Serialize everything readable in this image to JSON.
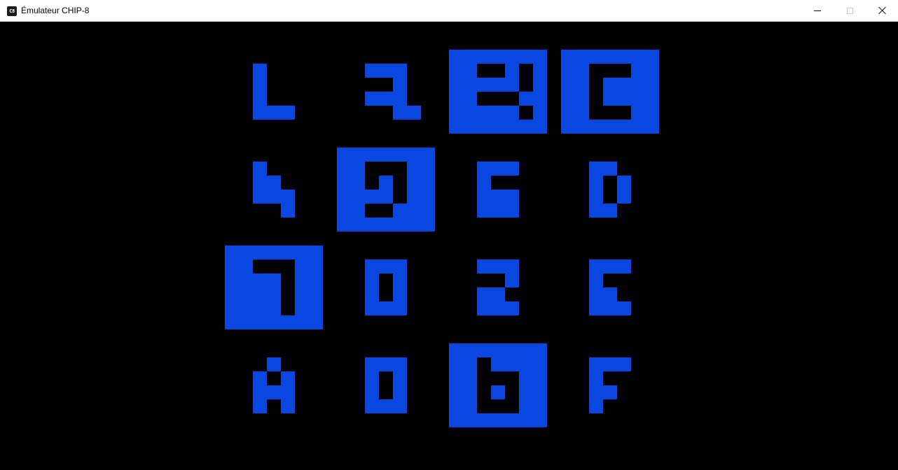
{
  "window": {
    "title": "Émulateur CHIP-8",
    "icon_label": "C8",
    "icon_name": "chip8-app-icon",
    "controls": [
      "minimize-icon",
      "maximize-icon",
      "close-icon"
    ]
  },
  "display": {
    "background": "#000000",
    "foreground": "#0a47e0"
  },
  "keypad": {
    "keys": [
      {
        "label": "1",
        "pressed": false
      },
      {
        "label": "2",
        "pressed": false
      },
      {
        "label": "3",
        "pressed": true
      },
      {
        "label": "C",
        "pressed": true
      },
      {
        "label": "4",
        "pressed": false
      },
      {
        "label": "5",
        "pressed": true
      },
      {
        "label": "6",
        "pressed": false
      },
      {
        "label": "D",
        "pressed": false
      },
      {
        "label": "7",
        "pressed": true
      },
      {
        "label": "8",
        "pressed": false
      },
      {
        "label": "9",
        "pressed": false
      },
      {
        "label": "E",
        "pressed": false
      },
      {
        "label": "A",
        "pressed": false
      },
      {
        "label": "0",
        "pressed": false
      },
      {
        "label": "B",
        "pressed": true
      },
      {
        "label": "F",
        "pressed": false
      }
    ]
  }
}
